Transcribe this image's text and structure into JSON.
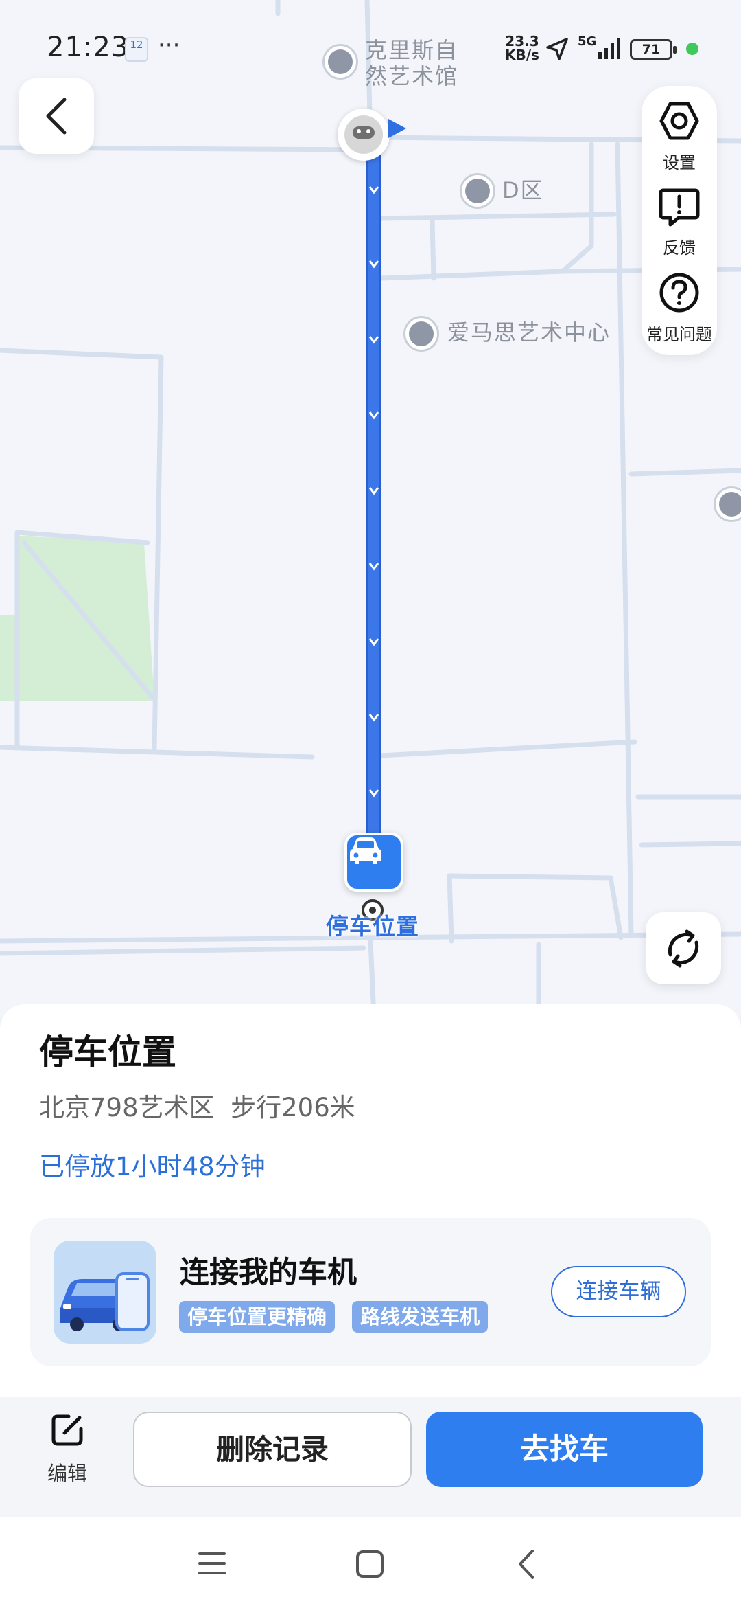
{
  "status_bar": {
    "time": "21:23",
    "calendar_day": "12",
    "more": "···",
    "net_speed_value": "23.3",
    "net_speed_unit": "KB/s",
    "network": "5G",
    "battery": "71"
  },
  "map": {
    "pois": {
      "gallery": "克里斯自然艺术馆",
      "d_zone": "D区",
      "hermes": "爱马思艺术中心"
    },
    "parking_label": "停车位置",
    "route_color": "#3b77e8"
  },
  "side_panel": {
    "settings": "设置",
    "feedback": "反馈",
    "faq": "常见问题"
  },
  "sheet": {
    "title": "停车位置",
    "subtitle": "北京798艺术区  步行206米",
    "parked_time": "已停放1小时48分钟"
  },
  "card": {
    "title": "连接我的车机",
    "tags": [
      "停车位置更精确",
      "路线发送车机"
    ],
    "button": "连接车辆"
  },
  "actions": {
    "edit": "编辑",
    "delete": "删除记录",
    "go": "去找车"
  },
  "colors": {
    "accent": "#2f7ef0",
    "text_blue": "#2b6fd8",
    "park_green": "#d4eed6"
  }
}
